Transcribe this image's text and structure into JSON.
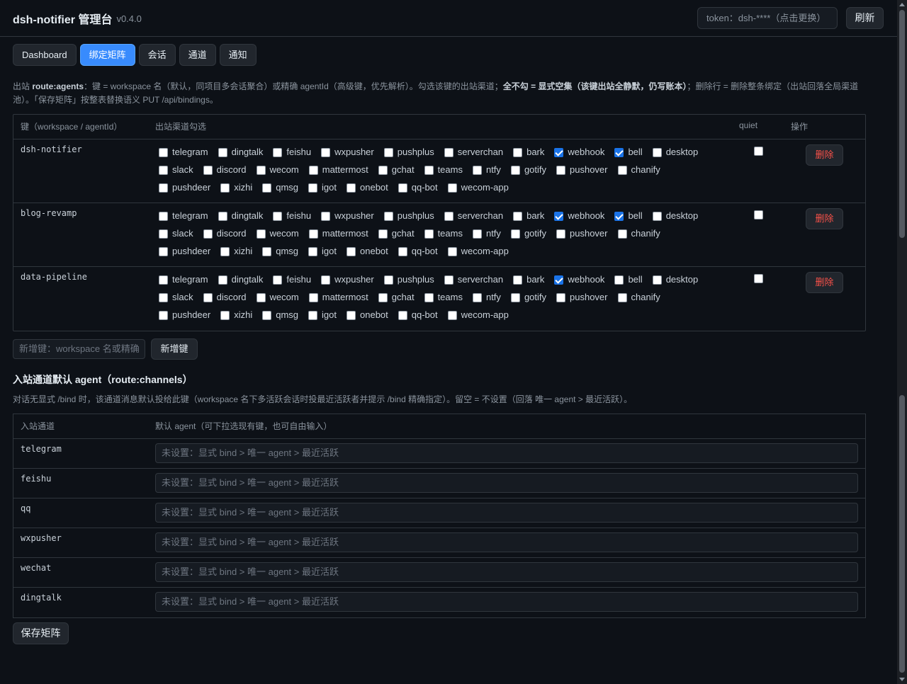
{
  "header": {
    "title": "dsh-notifier 管理台",
    "version": "v0.4.0",
    "token_placeholder": "token：dsh-****（点击更换）",
    "refresh_label": "刷新"
  },
  "tabs": [
    {
      "label": "Dashboard",
      "active": false
    },
    {
      "label": "绑定矩阵",
      "active": true
    },
    {
      "label": "会话",
      "active": false
    },
    {
      "label": "通道",
      "active": false
    },
    {
      "label": "通知",
      "active": false
    }
  ],
  "description": {
    "p1": "出站 ",
    "b1": "route:agents",
    "p2": "：键 = workspace 名（默认，同项目多会话聚合）或精确 agentId（高级键，优先解析）。勾选该键的出站渠道；",
    "b2": "全不勾 = 显式空集（该键出站全静默，仍写账本）",
    "p3": "；删除行 = 删除整条绑定（出站回落全局渠道池）。「保存矩阵」按整表替换语义 PUT /api/bindings。"
  },
  "bindings_table": {
    "headers": {
      "key": "键（workspace / agentId）",
      "channels": "出站渠道勾选",
      "quiet": "quiet",
      "actions": "操作"
    },
    "channel_lines": [
      [
        "telegram",
        "dingtalk",
        "feishu",
        "wxpusher",
        "pushplus",
        "serverchan",
        "bark",
        "webhook",
        "bell",
        "desktop"
      ],
      [
        "slack",
        "discord",
        "wecom",
        "mattermost",
        "gchat",
        "teams",
        "ntfy",
        "gotify",
        "pushover",
        "chanify"
      ],
      [
        "pushdeer",
        "xizhi",
        "qmsg",
        "igot",
        "onebot",
        "qq-bot",
        "wecom-app"
      ]
    ],
    "delete_label": "删除",
    "rows": [
      {
        "key": "dsh-notifier",
        "checked": [
          "webhook",
          "bell"
        ],
        "quiet": false
      },
      {
        "key": "blog-revamp",
        "checked": [
          "webhook",
          "bell"
        ],
        "quiet": false
      },
      {
        "key": "data-pipeline",
        "checked": [
          "webhook"
        ],
        "quiet": false
      }
    ]
  },
  "new_key": {
    "placeholder": "新增键：workspace 名或精确",
    "button_label": "新增键"
  },
  "channels_section": {
    "title": "入站通道默认 agent（route:channels）",
    "desc": "对话无显式 /bind 时，该通道消息默认投给此键（workspace 名下多活跃会话时投最近活跃者并提示 /bind 精确指定）。留空 = 不设置（回落 唯一 agent > 最近活跃）。",
    "headers": {
      "channel": "入站通道",
      "agent": "默认 agent（可下拉选现有键，也可自由输入）"
    },
    "agent_placeholder": "未设置：显式 bind > 唯一 agent > 最近活跃",
    "rows": [
      "telegram",
      "feishu",
      "qq",
      "wxpusher",
      "wechat",
      "dingtalk"
    ]
  },
  "save_label": "保存矩阵",
  "colors": {
    "accent": "#388bfd",
    "danger": "#f85149",
    "background": "#0d1117",
    "checkbox_checked": "#1a73e8"
  }
}
